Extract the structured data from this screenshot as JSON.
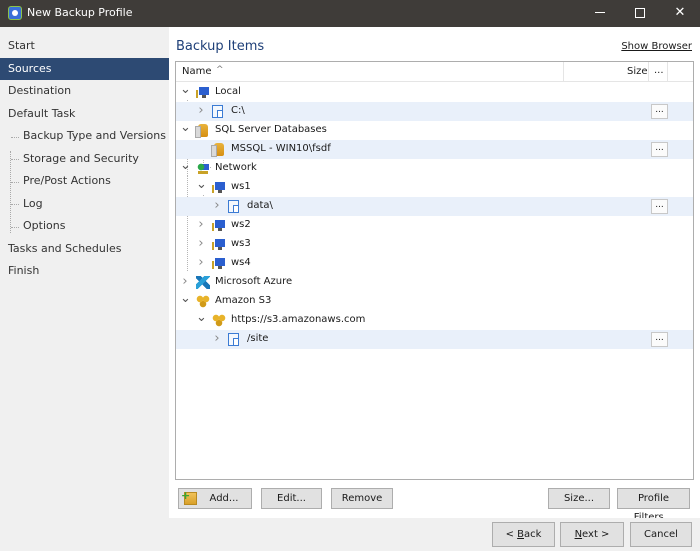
{
  "window": {
    "title": "New Backup Profile",
    "controls": {
      "minimize": "minimize",
      "maximize": "maximize",
      "close": "✕"
    }
  },
  "sidebar": {
    "items": [
      {
        "label": "Start",
        "level": 0,
        "active": false
      },
      {
        "label": "Sources",
        "level": 0,
        "active": true
      },
      {
        "label": "Destination",
        "level": 0,
        "active": false
      },
      {
        "label": "Default Task",
        "level": 0,
        "active": false
      },
      {
        "label": "Backup Type and Versions",
        "level": 1,
        "active": false
      },
      {
        "label": "Storage and Security",
        "level": 1,
        "active": false
      },
      {
        "label": "Pre/Post Actions",
        "level": 1,
        "active": false
      },
      {
        "label": "Log",
        "level": 1,
        "active": false
      },
      {
        "label": "Options",
        "level": 1,
        "active": false
      },
      {
        "label": "Tasks and Schedules",
        "level": 0,
        "active": false
      },
      {
        "label": "Finish",
        "level": 0,
        "active": false
      }
    ]
  },
  "main": {
    "heading": "Backup Items",
    "show_browser": "Show Browser",
    "columns": {
      "name": "Name",
      "sort_indicator": "^",
      "size": "Size",
      "more": "..."
    },
    "tree": [
      {
        "label": "Local",
        "icon": "computer-icon",
        "expander": "expanded",
        "highlighted": false,
        "has_more": false
      },
      {
        "label": "C:\\",
        "icon": "drive-icon",
        "expander": "collapsed",
        "highlighted": true,
        "has_more": true
      },
      {
        "label": "SQL Server Databases",
        "icon": "database-server-icon",
        "expander": "expanded",
        "highlighted": false,
        "has_more": false
      },
      {
        "label": "MSSQL - WIN10\\fsdf",
        "icon": "database-icon",
        "expander": "none",
        "highlighted": true,
        "has_more": true
      },
      {
        "label": "Network",
        "icon": "network-icon",
        "expander": "expanded",
        "highlighted": false,
        "has_more": false
      },
      {
        "label": "ws1",
        "icon": "computer-icon",
        "expander": "expanded",
        "highlighted": false,
        "has_more": false
      },
      {
        "label": "data\\",
        "icon": "drive-icon",
        "expander": "collapsed",
        "highlighted": true,
        "has_more": true
      },
      {
        "label": "ws2",
        "icon": "computer-icon",
        "expander": "collapsed",
        "highlighted": false,
        "has_more": false
      },
      {
        "label": "ws3",
        "icon": "computer-icon",
        "expander": "collapsed",
        "highlighted": false,
        "has_more": false
      },
      {
        "label": "ws4",
        "icon": "computer-icon",
        "expander": "collapsed",
        "highlighted": false,
        "has_more": false
      },
      {
        "label": "Microsoft Azure",
        "icon": "azure-icon",
        "expander": "collapsed",
        "highlighted": false,
        "has_more": false
      },
      {
        "label": "Amazon S3",
        "icon": "amazon-s3-icon",
        "expander": "expanded",
        "highlighted": false,
        "has_more": false
      },
      {
        "label": "https://s3.amazonaws.com",
        "icon": "amazon-s3-icon",
        "expander": "expanded",
        "highlighted": false,
        "has_more": false
      },
      {
        "label": "/site",
        "icon": "drive-icon",
        "expander": "collapsed",
        "highlighted": true,
        "has_more": true
      }
    ],
    "more_button_label": "..."
  },
  "actions": {
    "add": "Add...",
    "edit": "Edit...",
    "remove": "Remove",
    "size": "Size...",
    "profile_filters": "Profile Filters..."
  },
  "footer": {
    "back_prefix": "< ",
    "back_mnemonic": "B",
    "back_rest": "ack",
    "next_mnemonic": "N",
    "next_rest": "ext >",
    "cancel": "Cancel"
  }
}
